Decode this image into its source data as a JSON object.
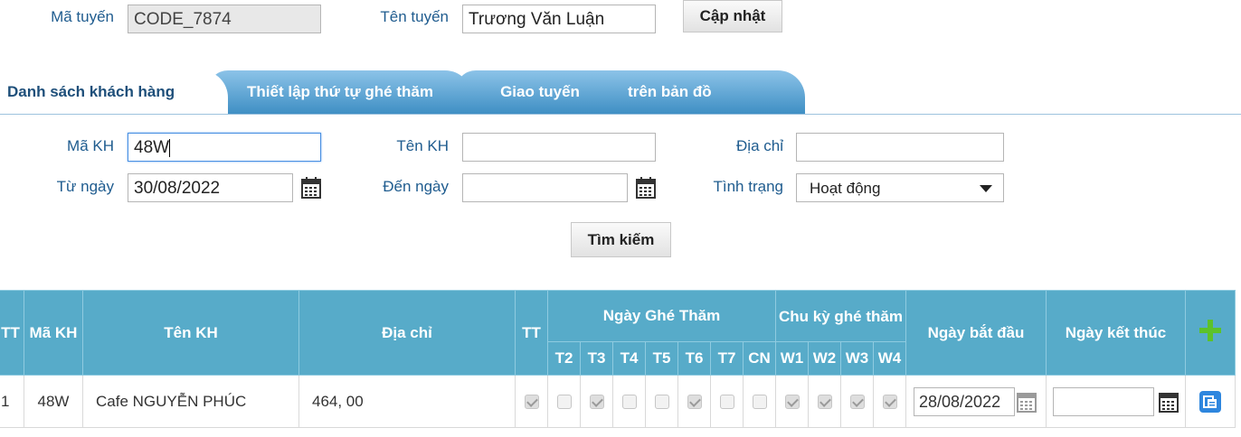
{
  "route": {
    "code_label": "Mã tuyến",
    "code_value": "CODE_7874",
    "name_label": "Tên tuyến",
    "name_value": "Trương Văn Luận",
    "update_button": "Cập nhật"
  },
  "tabs": [
    {
      "label": "Danh sách khách hàng",
      "active": true
    },
    {
      "label": "Thiết lập thứ tự ghé thăm",
      "active": false
    },
    {
      "label": "Giao tuyến",
      "active": false
    },
    {
      "label": "Xem trên bản đồ",
      "active": false
    }
  ],
  "filters": {
    "customer_code_label": "Mã KH",
    "customer_code_value": "48W",
    "customer_name_label": "Tên KH",
    "customer_name_value": "",
    "address_label": "Địa chỉ",
    "address_value": "",
    "from_date_label": "Từ ngày",
    "from_date_value": "30/08/2022",
    "to_date_label": "Đến ngày",
    "to_date_value": "",
    "status_label": "Tình trạng",
    "status_value": "Hoạt động",
    "search_button": "Tìm kiếm"
  },
  "table": {
    "headers": {
      "tt": "TT",
      "code": "Mã KH",
      "name": "Tên KH",
      "address": "Địa chỉ",
      "tt2": "TT",
      "visit_days": "Ngày Ghé Thăm",
      "cycle": "Chu kỳ ghé thăm",
      "start": "Ngày bắt đầu",
      "end": "Ngày kết thúc"
    },
    "days": [
      "T2",
      "T3",
      "T4",
      "T5",
      "T6",
      "T7",
      "CN"
    ],
    "weeks": [
      "W1",
      "W2",
      "W3",
      "W4"
    ],
    "rows": [
      {
        "tt": "1",
        "code": "48W",
        "name": "Cafe NGUYỄN PHÚC",
        "address": "464, 00",
        "tt_checked": true,
        "days_checked": [
          false,
          true,
          false,
          false,
          true,
          false,
          false
        ],
        "weeks_checked": [
          true,
          true,
          true,
          true
        ],
        "start_date": "28/08/2022",
        "end_date": ""
      }
    ]
  },
  "colors": {
    "header_bg": "#57abc9",
    "label": "#1f5c8f",
    "add_icon": "#5cc22a",
    "copy_icon": "#2e86de"
  }
}
